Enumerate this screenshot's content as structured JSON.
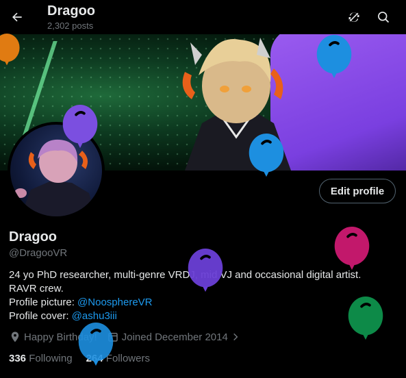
{
  "header": {
    "title": "Dragoo",
    "post_count": "2,302 posts",
    "back_icon": "arrow-left-icon",
    "refresh_icon": "refresh-icon",
    "search_icon": "search-icon"
  },
  "profile": {
    "edit_button": "Edit profile",
    "name": "Dragoo",
    "handle": "@DragooVR",
    "bio_line1": "24 yo PhD researcher, multi-genre VRDJ, mid VJ and occasional digital artist.",
    "bio_line2": "RAVR crew.",
    "pfp_label": "Profile picture: ",
    "pfp_link": "@NoosphereVR",
    "cover_label": "Profile cover: ",
    "cover_link": "@ashu3iii",
    "birthday": "Happy Birthday!",
    "joined": "Joined December 2014",
    "following_count": "336",
    "following_label": "Following",
    "followers_count": "264",
    "followers_label": "Followers"
  },
  "colors": {
    "background": "#000000",
    "text_primary": "#e7e9ea",
    "text_secondary": "#71767b",
    "link": "#1d9bf0",
    "border": "#536471"
  },
  "balloons": [
    {
      "color": "#e07b12"
    },
    {
      "color": "#1d8fe0"
    },
    {
      "color": "#7b4fe0"
    },
    {
      "color": "#1d8fe0"
    },
    {
      "color": "#c2186b"
    },
    {
      "color": "#6a3fd6"
    },
    {
      "color": "#0d8a48"
    },
    {
      "color": "#1d8fe0"
    }
  ]
}
